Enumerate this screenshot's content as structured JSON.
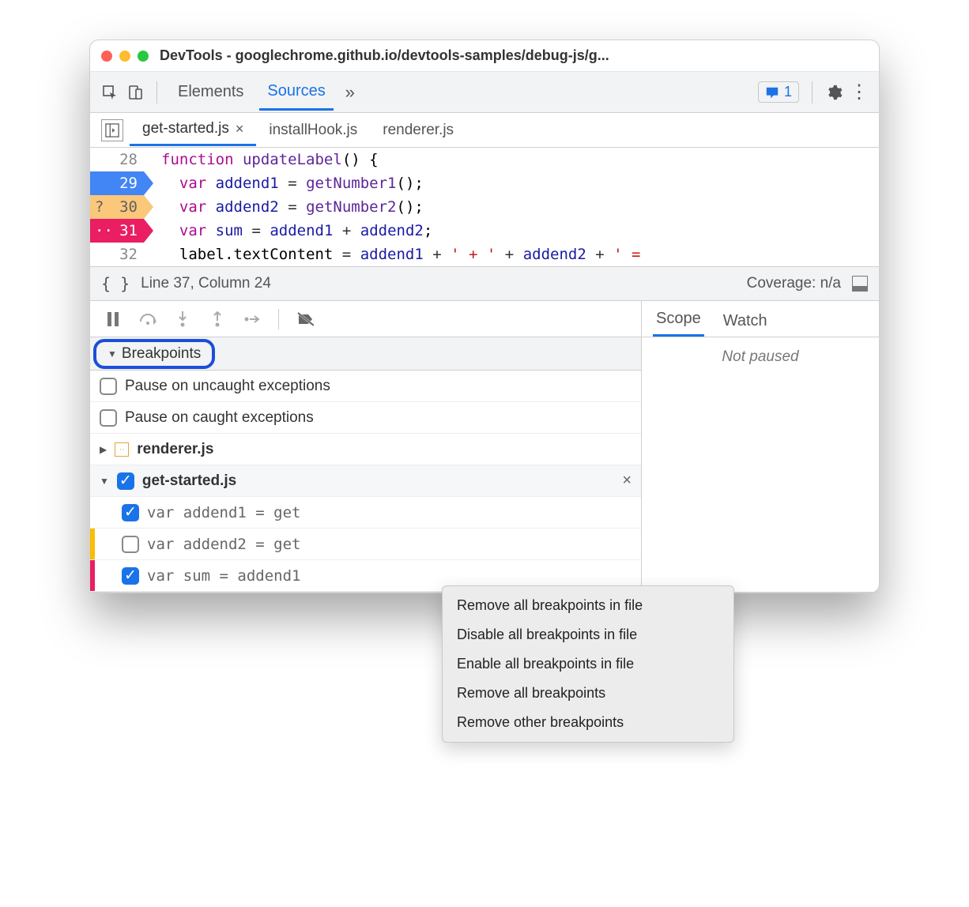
{
  "window": {
    "title": "DevTools - googlechrome.github.io/devtools-samples/debug-js/g..."
  },
  "toolbar": {
    "tabs": [
      {
        "label": "Elements",
        "active": false
      },
      {
        "label": "Sources",
        "active": true
      }
    ],
    "issues_count": "1"
  },
  "file_tabs": [
    {
      "label": "get-started.js",
      "active": true,
      "closeable": true
    },
    {
      "label": "installHook.js",
      "active": false,
      "closeable": false
    },
    {
      "label": "renderer.js",
      "active": false,
      "closeable": false
    }
  ],
  "code": {
    "lines": [
      {
        "num": "28",
        "bp": "",
        "html": "<span class='kw'>function</span> <span class='fn'>updateLabel</span>() {"
      },
      {
        "num": "29",
        "bp": "blue",
        "html": "  <span class='kw'>var</span> <span class='id'>addend1</span> <span class='op'>=</span> <span class='fn'>getNumber1</span>();"
      },
      {
        "num": "30",
        "bp": "orange",
        "prefix": "?",
        "html": "  <span class='kw'>var</span> <span class='id'>addend2</span> <span class='op'>=</span> <span class='fn'>getNumber2</span>();"
      },
      {
        "num": "31",
        "bp": "pink",
        "prefix": "··",
        "html": "  <span class='kw'>var</span> <span class='id'>sum</span> <span class='op'>=</span> <span class='id'>addend1</span> <span class='op'>+</span> <span class='id'>addend2</span>;"
      },
      {
        "num": "32",
        "bp": "",
        "html": "  label.textContent <span class='op'>=</span> <span class='id'>addend1</span> <span class='op'>+</span> <span class='str'>' + '</span> <span class='op'>+</span> <span class='id'>addend2</span> <span class='op'>+</span> <span class='str'>' =</span>"
      }
    ]
  },
  "status": {
    "cursor": "Line 37, Column 24",
    "coverage": "Coverage: n/a"
  },
  "breakpoints_section": {
    "header": "Breakpoints",
    "pause_uncaught": "Pause on uncaught exceptions",
    "pause_caught": "Pause on caught exceptions",
    "groups": [
      {
        "file": "renderer.js",
        "expanded": false,
        "checked": null
      },
      {
        "file": "get-started.js",
        "expanded": true,
        "checked": true,
        "items": [
          {
            "checked": true,
            "text": "var addend1 = get",
            "color": ""
          },
          {
            "checked": false,
            "text": "var addend2 = get",
            "color": "orange"
          },
          {
            "checked": true,
            "text": "var sum = addend1",
            "color": "pink"
          }
        ]
      }
    ]
  },
  "scope_panel": {
    "tabs": [
      {
        "label": "Scope",
        "active": true
      },
      {
        "label": "Watch",
        "active": false
      }
    ],
    "message": "Not paused"
  },
  "context_menu": [
    "Remove all breakpoints in file",
    "Disable all breakpoints in file",
    "Enable all breakpoints in file",
    "Remove all breakpoints",
    "Remove other breakpoints"
  ]
}
